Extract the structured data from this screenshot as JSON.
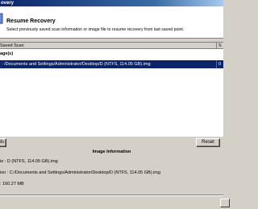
{
  "window": {
    "title": "overy"
  },
  "header": {
    "title": "Resume Recovery",
    "subtitle": "Select previously saved scan information or image file to resume recovery from last saved point."
  },
  "list": {
    "columns": [
      "Saved Scan",
      "S"
    ],
    "group_label": "age(s)",
    "rows": [
      {
        "path": ": /Documents and Settings/Administrator/Desktop/D (NTFS, 114.05 GB).img",
        "date": "0"
      }
    ]
  },
  "buttons": {
    "left_label": "ils",
    "reset_label": "Reset"
  },
  "image_info": {
    "title": "Image Information",
    "lines": [
      "ie : D (NTFS, 114.05 GB).img",
      "ion : C:/Documents and Settings/Administrator/Desktop/D (NTFS, 114.05 GB).img",
      ": 160.27 MB"
    ]
  },
  "colors": {
    "selection": "#0a246a",
    "face": "#d4d0c8",
    "titlebar": "#0a246a"
  },
  "icons": {
    "header_icon": "recovery-icon"
  }
}
